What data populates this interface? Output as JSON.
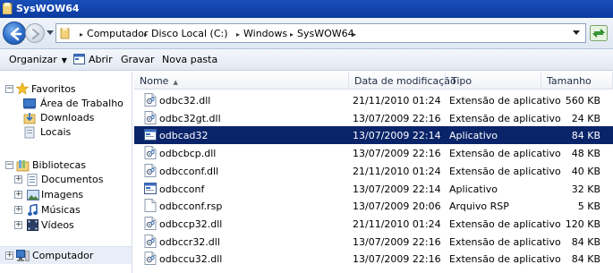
{
  "window": {
    "title": "SysWOW64"
  },
  "address": {
    "crumbs": [
      "Computador",
      "Disco Local (C:)",
      "Windows",
      "SysWOW64"
    ]
  },
  "toolbar": {
    "organize": "Organizar",
    "open": "Abrir",
    "burn": "Gravar",
    "new_folder": "Nova pasta"
  },
  "nav": {
    "favorites": "Favoritos",
    "desktop": "Área de Trabalho",
    "downloads": "Downloads",
    "places": "Locais",
    "libraries": "Bibliotecas",
    "documents": "Documentos",
    "images": "Imagens",
    "music": "Músicas",
    "videos": "Vídeos",
    "computer": "Computador"
  },
  "columns": {
    "name": "Nome",
    "date": "Data de modificação",
    "type": "Tipo",
    "size": "Tamanho"
  },
  "files": [
    {
      "name": "odbc32.dll",
      "date": "21/11/2010 01:24",
      "type": "Extensão de aplicativo",
      "size": "560 KB",
      "icon": "dll-icon"
    },
    {
      "name": "odbc32gt.dll",
      "date": "13/07/2009 22:16",
      "type": "Extensão de aplicativo",
      "size": "24 KB",
      "icon": "dll-icon"
    },
    {
      "name": "odbcad32",
      "date": "13/07/2009 22:14",
      "type": "Aplicativo",
      "size": "84 KB",
      "icon": "app-icon",
      "selected": true
    },
    {
      "name": "odbcbcp.dll",
      "date": "13/07/2009 22:16",
      "type": "Extensão de aplicativo",
      "size": "48 KB",
      "icon": "dll-icon"
    },
    {
      "name": "odbcconf.dll",
      "date": "21/11/2010 01:24",
      "type": "Extensão de aplicativo",
      "size": "40 KB",
      "icon": "dll-icon"
    },
    {
      "name": "odbcconf",
      "date": "13/07/2009 22:14",
      "type": "Aplicativo",
      "size": "32 KB",
      "icon": "app-icon"
    },
    {
      "name": "odbcconf.rsp",
      "date": "13/07/2009 20:06",
      "type": "Arquivo RSP",
      "size": "5 KB",
      "icon": "blank-file-icon"
    },
    {
      "name": "odbccp32.dll",
      "date": "21/11/2010 01:24",
      "type": "Extensão de aplicativo",
      "size": "120 KB",
      "icon": "dll-icon"
    },
    {
      "name": "odbccr32.dll",
      "date": "13/07/2009 22:16",
      "type": "Extensão de aplicativo",
      "size": "84 KB",
      "icon": "dll-icon"
    },
    {
      "name": "odbccu32.dll",
      "date": "13/07/2009 22:16",
      "type": "Extensão de aplicativo",
      "size": "84 KB",
      "icon": "dll-icon"
    }
  ],
  "colors": {
    "selection": "#0a246a",
    "titlebar": "#0a3aa0"
  }
}
